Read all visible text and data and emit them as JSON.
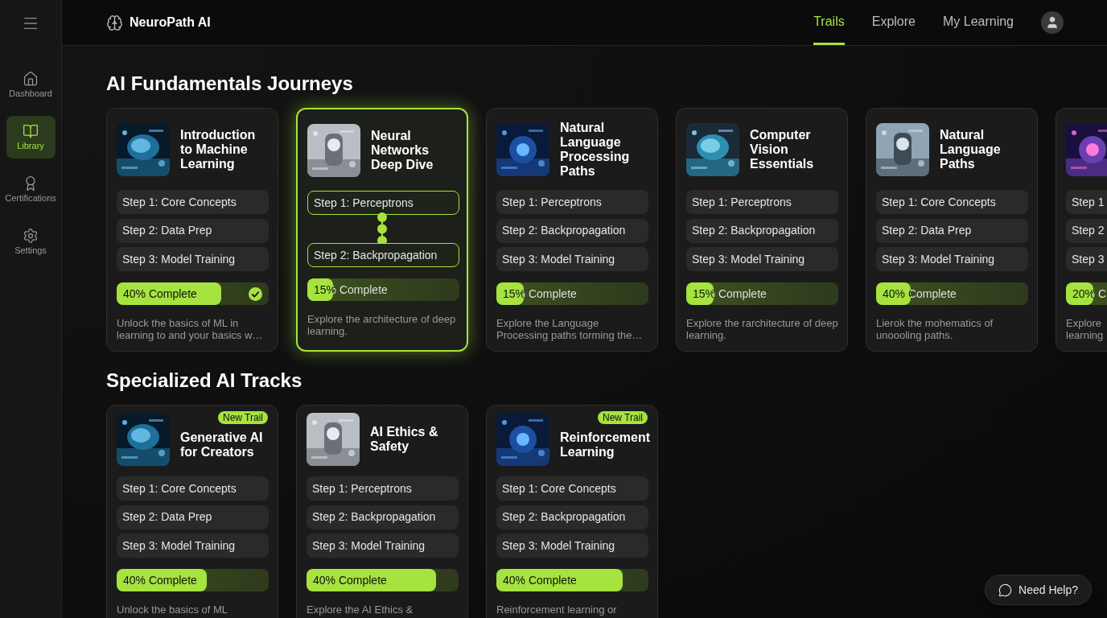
{
  "brand": {
    "name": "NeuroPath AI"
  },
  "nav": {
    "tabs": [
      {
        "label": "Trails",
        "selected": true
      },
      {
        "label": "Explore",
        "selected": false
      },
      {
        "label": "My Learning",
        "selected": false
      }
    ]
  },
  "sidebar": {
    "items": [
      {
        "label": "Dashboard",
        "selected": false
      },
      {
        "label": "Library",
        "selected": true
      },
      {
        "label": "Certifications",
        "selected": false
      },
      {
        "label": "Settings",
        "selected": false
      }
    ]
  },
  "sections": [
    {
      "title": "AI Fundamentals Journeys",
      "cards": [
        {
          "title": "Introduction to Machine Learning",
          "selected": false,
          "steps": [
            "Step 1: Core Concepts",
            "Step 2: Data Prep",
            "Step 3: Model Training"
          ],
          "progress": {
            "label": "40% Complete",
            "level": 0.69,
            "checked": true
          },
          "description": "Unlock the basics of ML in learning to and your basics w…"
        },
        {
          "title": "Neural Networks Deep Dive",
          "selected": true,
          "steps": [
            "Step 1: Perceptrons",
            "Step 2: Backpropagation"
          ],
          "progress": {
            "label": "15% Complete",
            "level": 0.17,
            "checked": false
          },
          "description": "Explore the architecture of deep learning."
        },
        {
          "title": "Natural Language Processing Paths",
          "selected": false,
          "steps": [
            "Step 1: Perceptrons",
            "Step 2: Backpropagation",
            "Step 3: Model Training"
          ],
          "progress": {
            "label": "15% Complete",
            "level": 0.18,
            "checked": false
          },
          "description": "Explore the Language Processing paths torming the…"
        },
        {
          "title": "Computer Vision Essentials",
          "selected": false,
          "steps": [
            "Step 1: Perceptrons",
            "Step 2: Backpropagation",
            "Step 3: Model Training"
          ],
          "progress": {
            "label": "15% Complete",
            "level": 0.18,
            "checked": false
          },
          "description": "Explore the rarchitecture of deep learning."
        },
        {
          "title": "Natural Language Paths",
          "selected": false,
          "steps": [
            "Step 1: Core Concepts",
            "Step 2: Data Prep",
            "Step 3: Model Training"
          ],
          "progress": {
            "label": "40% Complete",
            "level": 0.23,
            "checked": false
          },
          "description": "Lierok the mohematics of unoooling paths."
        },
        {
          "selected": false,
          "steps": [
            "Step 1",
            "Step 2",
            "Step 3"
          ],
          "progress": {
            "label": "20% C",
            "level": 0.18,
            "checked": false
          },
          "description": "Explore\nlearning"
        }
      ]
    },
    {
      "title": "Specialized AI Tracks",
      "cards": [
        {
          "title": "Generative AI for Creators",
          "badge": "New Trail",
          "selected": false,
          "steps": [
            "Step 1: Core Concepts",
            "Step 2: Data Prep",
            "Step 3: Model Training"
          ],
          "progress": {
            "label": "40% Complete",
            "level": 0.59,
            "checked": false
          },
          "description": "Unlock the basics of ML"
        },
        {
          "title": "AI Ethics & Safety",
          "selected": false,
          "steps": [
            "Step 1: Perceptrons",
            "Step 2: Backpropagation",
            "Step 3: Model Training"
          ],
          "progress": {
            "label": "40% Complete",
            "level": 0.85,
            "checked": false
          },
          "description": "Explore the AI Ethics &"
        },
        {
          "title": "Reinforcement Learning",
          "badge": "New Trail",
          "selected": false,
          "steps": [
            "Step 1: Core Concepts",
            "Step 2: Backpropagation",
            "Step 3: Model Training"
          ],
          "progress": {
            "label": "40% Complete",
            "level": 0.83,
            "checked": false
          },
          "description": "Reinforcement learning or"
        }
      ]
    }
  ],
  "help_button": {
    "label": "Need Help?"
  }
}
